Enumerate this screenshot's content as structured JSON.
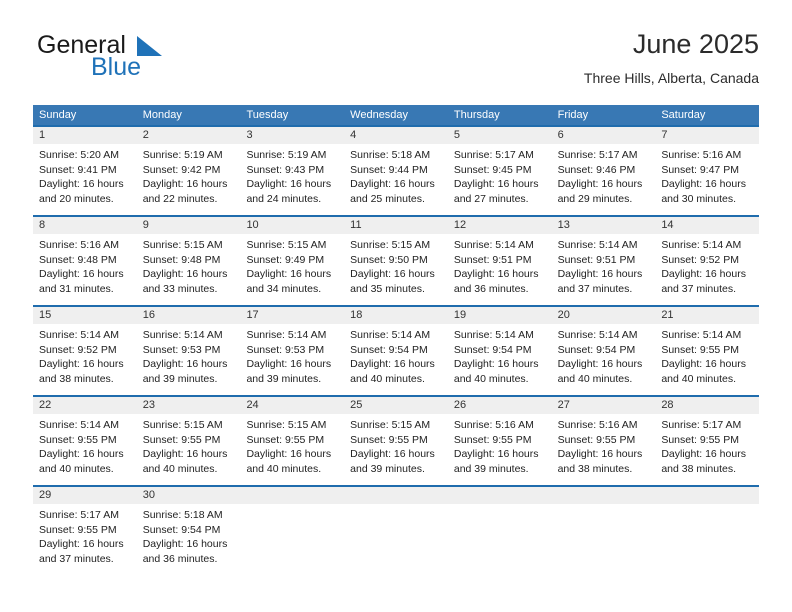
{
  "brand": {
    "name_part1": "General",
    "name_part2": "Blue",
    "flag_icon": "triangle-flag-icon"
  },
  "header": {
    "title": "June 2025",
    "location": "Three Hills, Alberta, Canada"
  },
  "colors": {
    "header_blue": "#3878b4",
    "row_divider_blue": "#1f6cad",
    "day_band_gray": "#efefef",
    "brand_blue": "#1f72b8"
  },
  "weekdays": [
    "Sunday",
    "Monday",
    "Tuesday",
    "Wednesday",
    "Thursday",
    "Friday",
    "Saturday"
  ],
  "weeks": [
    [
      {
        "day": "1",
        "sunrise": "Sunrise: 5:20 AM",
        "sunset": "Sunset: 9:41 PM",
        "daylight_line1": "Daylight: 16 hours",
        "daylight_line2": "and 20 minutes."
      },
      {
        "day": "2",
        "sunrise": "Sunrise: 5:19 AM",
        "sunset": "Sunset: 9:42 PM",
        "daylight_line1": "Daylight: 16 hours",
        "daylight_line2": "and 22 minutes."
      },
      {
        "day": "3",
        "sunrise": "Sunrise: 5:19 AM",
        "sunset": "Sunset: 9:43 PM",
        "daylight_line1": "Daylight: 16 hours",
        "daylight_line2": "and 24 minutes."
      },
      {
        "day": "4",
        "sunrise": "Sunrise: 5:18 AM",
        "sunset": "Sunset: 9:44 PM",
        "daylight_line1": "Daylight: 16 hours",
        "daylight_line2": "and 25 minutes."
      },
      {
        "day": "5",
        "sunrise": "Sunrise: 5:17 AM",
        "sunset": "Sunset: 9:45 PM",
        "daylight_line1": "Daylight: 16 hours",
        "daylight_line2": "and 27 minutes."
      },
      {
        "day": "6",
        "sunrise": "Sunrise: 5:17 AM",
        "sunset": "Sunset: 9:46 PM",
        "daylight_line1": "Daylight: 16 hours",
        "daylight_line2": "and 29 minutes."
      },
      {
        "day": "7",
        "sunrise": "Sunrise: 5:16 AM",
        "sunset": "Sunset: 9:47 PM",
        "daylight_line1": "Daylight: 16 hours",
        "daylight_line2": "and 30 minutes."
      }
    ],
    [
      {
        "day": "8",
        "sunrise": "Sunrise: 5:16 AM",
        "sunset": "Sunset: 9:48 PM",
        "daylight_line1": "Daylight: 16 hours",
        "daylight_line2": "and 31 minutes."
      },
      {
        "day": "9",
        "sunrise": "Sunrise: 5:15 AM",
        "sunset": "Sunset: 9:48 PM",
        "daylight_line1": "Daylight: 16 hours",
        "daylight_line2": "and 33 minutes."
      },
      {
        "day": "10",
        "sunrise": "Sunrise: 5:15 AM",
        "sunset": "Sunset: 9:49 PM",
        "daylight_line1": "Daylight: 16 hours",
        "daylight_line2": "and 34 minutes."
      },
      {
        "day": "11",
        "sunrise": "Sunrise: 5:15 AM",
        "sunset": "Sunset: 9:50 PM",
        "daylight_line1": "Daylight: 16 hours",
        "daylight_line2": "and 35 minutes."
      },
      {
        "day": "12",
        "sunrise": "Sunrise: 5:14 AM",
        "sunset": "Sunset: 9:51 PM",
        "daylight_line1": "Daylight: 16 hours",
        "daylight_line2": "and 36 minutes."
      },
      {
        "day": "13",
        "sunrise": "Sunrise: 5:14 AM",
        "sunset": "Sunset: 9:51 PM",
        "daylight_line1": "Daylight: 16 hours",
        "daylight_line2": "and 37 minutes."
      },
      {
        "day": "14",
        "sunrise": "Sunrise: 5:14 AM",
        "sunset": "Sunset: 9:52 PM",
        "daylight_line1": "Daylight: 16 hours",
        "daylight_line2": "and 37 minutes."
      }
    ],
    [
      {
        "day": "15",
        "sunrise": "Sunrise: 5:14 AM",
        "sunset": "Sunset: 9:52 PM",
        "daylight_line1": "Daylight: 16 hours",
        "daylight_line2": "and 38 minutes."
      },
      {
        "day": "16",
        "sunrise": "Sunrise: 5:14 AM",
        "sunset": "Sunset: 9:53 PM",
        "daylight_line1": "Daylight: 16 hours",
        "daylight_line2": "and 39 minutes."
      },
      {
        "day": "17",
        "sunrise": "Sunrise: 5:14 AM",
        "sunset": "Sunset: 9:53 PM",
        "daylight_line1": "Daylight: 16 hours",
        "daylight_line2": "and 39 minutes."
      },
      {
        "day": "18",
        "sunrise": "Sunrise: 5:14 AM",
        "sunset": "Sunset: 9:54 PM",
        "daylight_line1": "Daylight: 16 hours",
        "daylight_line2": "and 40 minutes."
      },
      {
        "day": "19",
        "sunrise": "Sunrise: 5:14 AM",
        "sunset": "Sunset: 9:54 PM",
        "daylight_line1": "Daylight: 16 hours",
        "daylight_line2": "and 40 minutes."
      },
      {
        "day": "20",
        "sunrise": "Sunrise: 5:14 AM",
        "sunset": "Sunset: 9:54 PM",
        "daylight_line1": "Daylight: 16 hours",
        "daylight_line2": "and 40 minutes."
      },
      {
        "day": "21",
        "sunrise": "Sunrise: 5:14 AM",
        "sunset": "Sunset: 9:55 PM",
        "daylight_line1": "Daylight: 16 hours",
        "daylight_line2": "and 40 minutes."
      }
    ],
    [
      {
        "day": "22",
        "sunrise": "Sunrise: 5:14 AM",
        "sunset": "Sunset: 9:55 PM",
        "daylight_line1": "Daylight: 16 hours",
        "daylight_line2": "and 40 minutes."
      },
      {
        "day": "23",
        "sunrise": "Sunrise: 5:15 AM",
        "sunset": "Sunset: 9:55 PM",
        "daylight_line1": "Daylight: 16 hours",
        "daylight_line2": "and 40 minutes."
      },
      {
        "day": "24",
        "sunrise": "Sunrise: 5:15 AM",
        "sunset": "Sunset: 9:55 PM",
        "daylight_line1": "Daylight: 16 hours",
        "daylight_line2": "and 40 minutes."
      },
      {
        "day": "25",
        "sunrise": "Sunrise: 5:15 AM",
        "sunset": "Sunset: 9:55 PM",
        "daylight_line1": "Daylight: 16 hours",
        "daylight_line2": "and 39 minutes."
      },
      {
        "day": "26",
        "sunrise": "Sunrise: 5:16 AM",
        "sunset": "Sunset: 9:55 PM",
        "daylight_line1": "Daylight: 16 hours",
        "daylight_line2": "and 39 minutes."
      },
      {
        "day": "27",
        "sunrise": "Sunrise: 5:16 AM",
        "sunset": "Sunset: 9:55 PM",
        "daylight_line1": "Daylight: 16 hours",
        "daylight_line2": "and 38 minutes."
      },
      {
        "day": "28",
        "sunrise": "Sunrise: 5:17 AM",
        "sunset": "Sunset: 9:55 PM",
        "daylight_line1": "Daylight: 16 hours",
        "daylight_line2": "and 38 minutes."
      }
    ],
    [
      {
        "day": "29",
        "sunrise": "Sunrise: 5:17 AM",
        "sunset": "Sunset: 9:55 PM",
        "daylight_line1": "Daylight: 16 hours",
        "daylight_line2": "and 37 minutes."
      },
      {
        "day": "30",
        "sunrise": "Sunrise: 5:18 AM",
        "sunset": "Sunset: 9:54 PM",
        "daylight_line1": "Daylight: 16 hours",
        "daylight_line2": "and 36 minutes."
      },
      {
        "day": "",
        "sunrise": "",
        "sunset": "",
        "daylight_line1": "",
        "daylight_line2": ""
      },
      {
        "day": "",
        "sunrise": "",
        "sunset": "",
        "daylight_line1": "",
        "daylight_line2": ""
      },
      {
        "day": "",
        "sunrise": "",
        "sunset": "",
        "daylight_line1": "",
        "daylight_line2": ""
      },
      {
        "day": "",
        "sunrise": "",
        "sunset": "",
        "daylight_line1": "",
        "daylight_line2": ""
      },
      {
        "day": "",
        "sunrise": "",
        "sunset": "",
        "daylight_line1": "",
        "daylight_line2": ""
      }
    ]
  ]
}
